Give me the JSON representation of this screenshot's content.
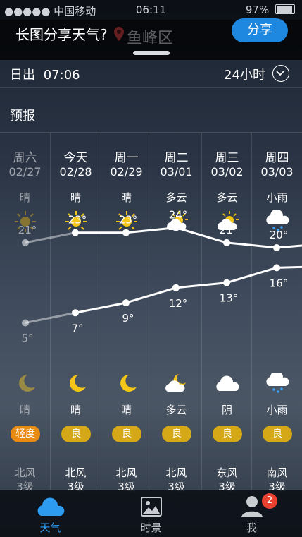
{
  "status_bar": {
    "carrier": "●●●●● 中国移动",
    "time": "06:11",
    "battery": "97%"
  },
  "share_prompt": {
    "text": "长图分享天气?",
    "button": "分享",
    "location": "鱼峰区"
  },
  "sunrise": {
    "label": "日出",
    "time": "07:06",
    "hours_toggle": "24小时"
  },
  "section_title": "预报",
  "days": [
    {
      "weekday": "周六",
      "date": "02/27",
      "day_cond": "晴",
      "day_icon": "sun-icon",
      "high": "21°",
      "low": "5°",
      "night_icon": "moon-icon",
      "night_cond": "晴",
      "aqi": "轻度",
      "wind_dir": "北风",
      "wind_level": "3级",
      "past": true
    },
    {
      "weekday": "今天",
      "date": "02/28",
      "day_cond": "晴",
      "day_icon": "sun-icon",
      "high": "23°",
      "low": "7°",
      "night_icon": "moon-icon",
      "night_cond": "晴",
      "aqi": "良",
      "wind_dir": "北风",
      "wind_level": "3级"
    },
    {
      "weekday": "周一",
      "date": "02/29",
      "day_cond": "晴",
      "day_icon": "sun-icon",
      "high": "23°",
      "low": "9°",
      "night_icon": "moon-icon",
      "night_cond": "晴",
      "aqi": "良",
      "wind_dir": "北风",
      "wind_level": "3级"
    },
    {
      "weekday": "周二",
      "date": "03/01",
      "day_cond": "多云",
      "day_icon": "partly-cloudy-icon",
      "high": "24°",
      "low": "12°",
      "night_icon": "cloudy-night-icon",
      "night_cond": "多云",
      "aqi": "良",
      "wind_dir": "北风",
      "wind_level": "3级"
    },
    {
      "weekday": "周三",
      "date": "03/02",
      "day_cond": "多云",
      "day_icon": "partly-cloudy-icon",
      "high": "21°",
      "low": "13°",
      "night_icon": "cloud-icon",
      "night_cond": "阴",
      "aqi": "良",
      "wind_dir": "东风",
      "wind_level": "3级"
    },
    {
      "weekday": "周四",
      "date": "03/03",
      "day_cond": "小雨",
      "day_icon": "light-rain-icon",
      "high": "20°",
      "low": "16°",
      "night_icon": "light-rain-icon",
      "night_cond": "小雨",
      "aqi": "良",
      "wind_dir": "南风",
      "wind_level": "3级"
    }
  ],
  "chart_data": {
    "type": "line",
    "categories": [
      "02/27",
      "02/28",
      "02/29",
      "03/01",
      "03/02",
      "03/03"
    ],
    "series": [
      {
        "values": [
          21,
          23,
          23,
          24,
          21,
          20
        ]
      },
      {
        "values": [
          5,
          7,
          9,
          12,
          13,
          16
        ]
      }
    ]
  },
  "tabs": [
    {
      "label": "天气",
      "icon": "cloud-tab-icon"
    },
    {
      "label": "时景",
      "icon": "photo-icon"
    },
    {
      "label": "我",
      "icon": "user-icon",
      "badge": "2"
    }
  ],
  "colors": {
    "accent": "#1e88e0",
    "aqi_good": "#d4a816",
    "aqi_light": "#e98a12",
    "badge": "#e9412f"
  }
}
